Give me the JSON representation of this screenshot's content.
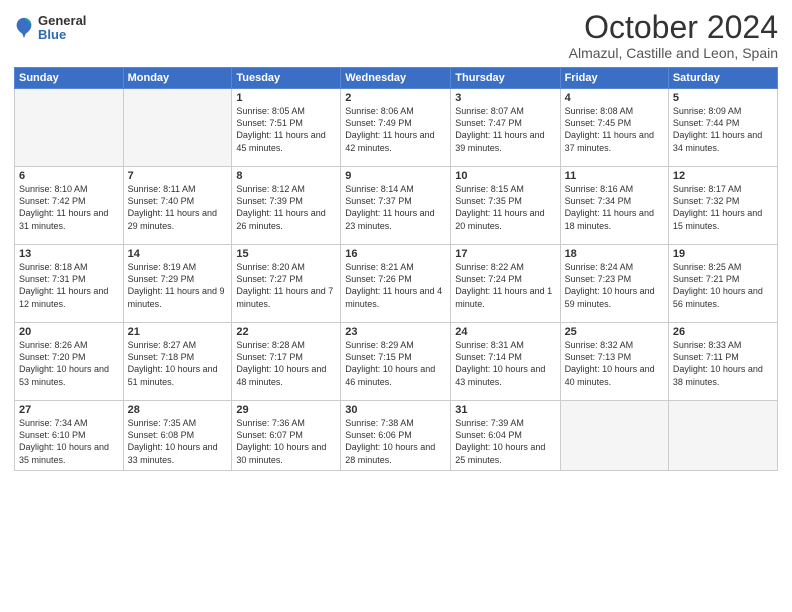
{
  "logo": {
    "general": "General",
    "blue": "Blue"
  },
  "header": {
    "month": "October 2024",
    "location": "Almazul, Castille and Leon, Spain"
  },
  "weekdays": [
    "Sunday",
    "Monday",
    "Tuesday",
    "Wednesday",
    "Thursday",
    "Friday",
    "Saturday"
  ],
  "weeks": [
    [
      {
        "day": "",
        "info": ""
      },
      {
        "day": "",
        "info": ""
      },
      {
        "day": "1",
        "info": "Sunrise: 8:05 AM\nSunset: 7:51 PM\nDaylight: 11 hours and 45 minutes."
      },
      {
        "day": "2",
        "info": "Sunrise: 8:06 AM\nSunset: 7:49 PM\nDaylight: 11 hours and 42 minutes."
      },
      {
        "day": "3",
        "info": "Sunrise: 8:07 AM\nSunset: 7:47 PM\nDaylight: 11 hours and 39 minutes."
      },
      {
        "day": "4",
        "info": "Sunrise: 8:08 AM\nSunset: 7:45 PM\nDaylight: 11 hours and 37 minutes."
      },
      {
        "day": "5",
        "info": "Sunrise: 8:09 AM\nSunset: 7:44 PM\nDaylight: 11 hours and 34 minutes."
      }
    ],
    [
      {
        "day": "6",
        "info": "Sunrise: 8:10 AM\nSunset: 7:42 PM\nDaylight: 11 hours and 31 minutes."
      },
      {
        "day": "7",
        "info": "Sunrise: 8:11 AM\nSunset: 7:40 PM\nDaylight: 11 hours and 29 minutes."
      },
      {
        "day": "8",
        "info": "Sunrise: 8:12 AM\nSunset: 7:39 PM\nDaylight: 11 hours and 26 minutes."
      },
      {
        "day": "9",
        "info": "Sunrise: 8:14 AM\nSunset: 7:37 PM\nDaylight: 11 hours and 23 minutes."
      },
      {
        "day": "10",
        "info": "Sunrise: 8:15 AM\nSunset: 7:35 PM\nDaylight: 11 hours and 20 minutes."
      },
      {
        "day": "11",
        "info": "Sunrise: 8:16 AM\nSunset: 7:34 PM\nDaylight: 11 hours and 18 minutes."
      },
      {
        "day": "12",
        "info": "Sunrise: 8:17 AM\nSunset: 7:32 PM\nDaylight: 11 hours and 15 minutes."
      }
    ],
    [
      {
        "day": "13",
        "info": "Sunrise: 8:18 AM\nSunset: 7:31 PM\nDaylight: 11 hours and 12 minutes."
      },
      {
        "day": "14",
        "info": "Sunrise: 8:19 AM\nSunset: 7:29 PM\nDaylight: 11 hours and 9 minutes."
      },
      {
        "day": "15",
        "info": "Sunrise: 8:20 AM\nSunset: 7:27 PM\nDaylight: 11 hours and 7 minutes."
      },
      {
        "day": "16",
        "info": "Sunrise: 8:21 AM\nSunset: 7:26 PM\nDaylight: 11 hours and 4 minutes."
      },
      {
        "day": "17",
        "info": "Sunrise: 8:22 AM\nSunset: 7:24 PM\nDaylight: 11 hours and 1 minute."
      },
      {
        "day": "18",
        "info": "Sunrise: 8:24 AM\nSunset: 7:23 PM\nDaylight: 10 hours and 59 minutes."
      },
      {
        "day": "19",
        "info": "Sunrise: 8:25 AM\nSunset: 7:21 PM\nDaylight: 10 hours and 56 minutes."
      }
    ],
    [
      {
        "day": "20",
        "info": "Sunrise: 8:26 AM\nSunset: 7:20 PM\nDaylight: 10 hours and 53 minutes."
      },
      {
        "day": "21",
        "info": "Sunrise: 8:27 AM\nSunset: 7:18 PM\nDaylight: 10 hours and 51 minutes."
      },
      {
        "day": "22",
        "info": "Sunrise: 8:28 AM\nSunset: 7:17 PM\nDaylight: 10 hours and 48 minutes."
      },
      {
        "day": "23",
        "info": "Sunrise: 8:29 AM\nSunset: 7:15 PM\nDaylight: 10 hours and 46 minutes."
      },
      {
        "day": "24",
        "info": "Sunrise: 8:31 AM\nSunset: 7:14 PM\nDaylight: 10 hours and 43 minutes."
      },
      {
        "day": "25",
        "info": "Sunrise: 8:32 AM\nSunset: 7:13 PM\nDaylight: 10 hours and 40 minutes."
      },
      {
        "day": "26",
        "info": "Sunrise: 8:33 AM\nSunset: 7:11 PM\nDaylight: 10 hours and 38 minutes."
      }
    ],
    [
      {
        "day": "27",
        "info": "Sunrise: 7:34 AM\nSunset: 6:10 PM\nDaylight: 10 hours and 35 minutes."
      },
      {
        "day": "28",
        "info": "Sunrise: 7:35 AM\nSunset: 6:08 PM\nDaylight: 10 hours and 33 minutes."
      },
      {
        "day": "29",
        "info": "Sunrise: 7:36 AM\nSunset: 6:07 PM\nDaylight: 10 hours and 30 minutes."
      },
      {
        "day": "30",
        "info": "Sunrise: 7:38 AM\nSunset: 6:06 PM\nDaylight: 10 hours and 28 minutes."
      },
      {
        "day": "31",
        "info": "Sunrise: 7:39 AM\nSunset: 6:04 PM\nDaylight: 10 hours and 25 minutes."
      },
      {
        "day": "",
        "info": ""
      },
      {
        "day": "",
        "info": ""
      }
    ]
  ]
}
